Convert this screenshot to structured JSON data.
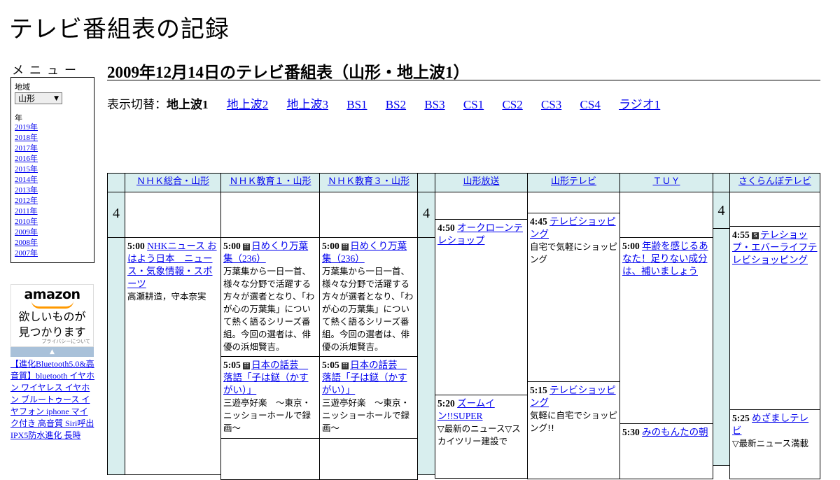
{
  "site": {
    "title": "テレビ番組表の記録"
  },
  "menu": {
    "heading": "メニュー",
    "region_label": "地域",
    "region_value": "山形",
    "year_label": "年",
    "years": [
      "2019年",
      "2018年",
      "2017年",
      "2016年",
      "2015年",
      "2014年",
      "2013年",
      "2012年",
      "2011年",
      "2010年",
      "2009年",
      "2008年",
      "2007年"
    ]
  },
  "ad": {
    "logo": "amazon",
    "tagline_1": "欲しいものが",
    "tagline_2": "見つかります",
    "privacy": "プライバシーについて",
    "product": "【進化Bluetooth5.0&高音質】bluetooth イヤホン ワイヤレス イヤホン ブルートゥース イヤフォン iphone マイク付き 高音質 Siri呼出 IPX5防水進化 長時"
  },
  "page": {
    "heading": "2009年12月14日のテレビ番組表（山形・地上波1）",
    "switch_label": "表示切替：",
    "switch_current": "地上波1",
    "switch_links": [
      "地上波2",
      "地上波3",
      "BS1",
      "BS2",
      "BS3",
      "CS1",
      "CS2",
      "CS3",
      "CS4",
      "ラジオ1"
    ]
  },
  "channels": [
    "ＮＨＫ総合・山形",
    "ＮＨＫ教育１・山形",
    "ＮＨＫ教育３・山形",
    "山形放送",
    "山形テレビ",
    "ＴＵＹ",
    "さくらんぼテレビ"
  ],
  "hour": "4",
  "programs": {
    "nhk1_500": {
      "time": "5:00",
      "title": "NHKニュース おはよう日本　ニュース・気象情報・スポーツ",
      "desc": "高瀬耕造，守本奈実"
    },
    "edu1_500": {
      "time": "5:00",
      "title": "日めくり万葉集（236）",
      "desc": "万葉集から一日一首、様々な分野で活躍する方々が選者となり、「わが心の万葉集」について熱く語るシリーズ番組。今回の選者は、俳優の浜畑賢吉。"
    },
    "edu3_500": {
      "time": "5:00",
      "title": "日めくり万葉集（236）",
      "desc": "万葉集から一日一首、様々な分野で活躍する方々が選者となり、「わが心の万葉集」について熱く語るシリーズ番組。今回の選者は、俳優の浜畑賢吉。"
    },
    "edu1_505": {
      "time": "5:05",
      "title": "日本の話芸　落語「子は鎹（かすがい）」",
      "desc": "三遊亭好楽　～東京・ニッショーホールで録画～"
    },
    "edu3_505": {
      "time": "5:05",
      "title": "日本の話芸　落語「子は鎹（かすがい）」",
      "desc": "三遊亭好楽　～東京・ニッショーホールで録画～"
    },
    "ybc_450": {
      "time": "4:50",
      "title": "オークローンテレショップ",
      "desc": ""
    },
    "ybc_520": {
      "time": "5:20",
      "title": "ズームイン!!SUPER",
      "desc": "▽最新のニュース▽スカイツリー建設で"
    },
    "yts_445": {
      "time": "4:45",
      "title": "テレビショッピング",
      "desc": "自宅で気軽にショッピング"
    },
    "yts_515": {
      "time": "5:15",
      "title": "テレビショッピング",
      "desc": "気軽に自宅でショッピング!!"
    },
    "tuy_500": {
      "time": "5:00",
      "title": "年齢を感じるあなた！足りない成分は、補いましょう",
      "desc": ""
    },
    "tuy_530": {
      "time": "5:30",
      "title": "みのもんたの朝",
      "desc": ""
    },
    "say_455": {
      "time": "4:55",
      "title": "テレショップ・エバーライフテレビショッピング",
      "desc": ""
    },
    "say_525": {
      "time": "5:25",
      "title": "めざましテレビ",
      "desc": "▽最新ニュース満載"
    }
  },
  "colors": {
    "header_bg": "#d8eeee",
    "link": "#0000ee"
  },
  "icons": {
    "data_broadcast": "data-broadcast-icon",
    "subtitle": "caption-icon"
  }
}
